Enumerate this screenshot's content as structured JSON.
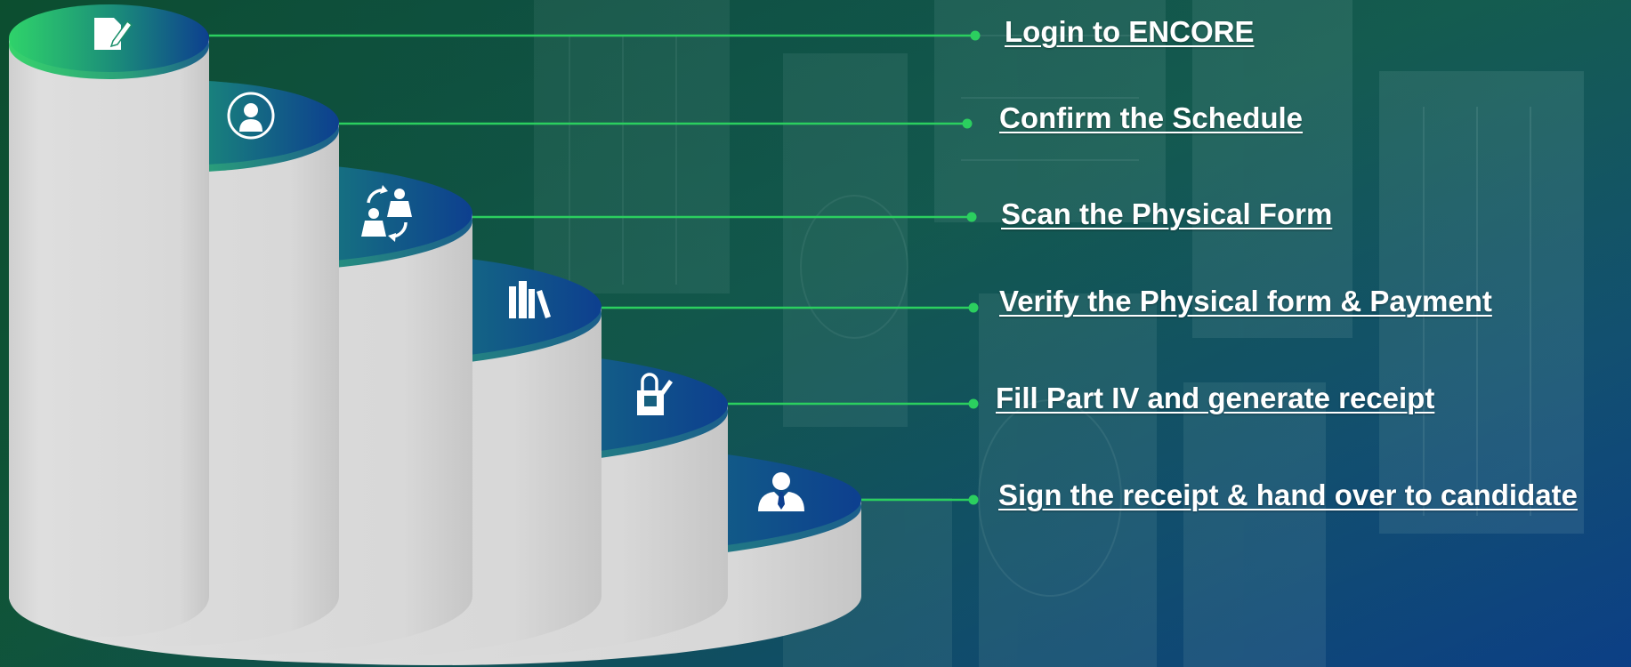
{
  "steps": [
    {
      "label": "Login to ENCORE",
      "icon": "form-edit-icon"
    },
    {
      "label": "Confirm the Schedule",
      "icon": "user-profile-icon"
    },
    {
      "label": "Scan the Physical Form",
      "icon": "people-exchange-icon"
    },
    {
      "label": "Verify the Physical form & Payment",
      "icon": "books-icon"
    },
    {
      "label": "Fill Part IV and generate receipt",
      "icon": "box-edit-icon"
    },
    {
      "label": "Sign the receipt & hand over to candidate",
      "icon": "person-tie-icon"
    }
  ],
  "colors": {
    "top_green": "#2fd36a",
    "top_blue": "#0d3f8f",
    "side_gray": "#d9d9d9",
    "connector": "#2bcf5f",
    "label": "#ffffff"
  }
}
